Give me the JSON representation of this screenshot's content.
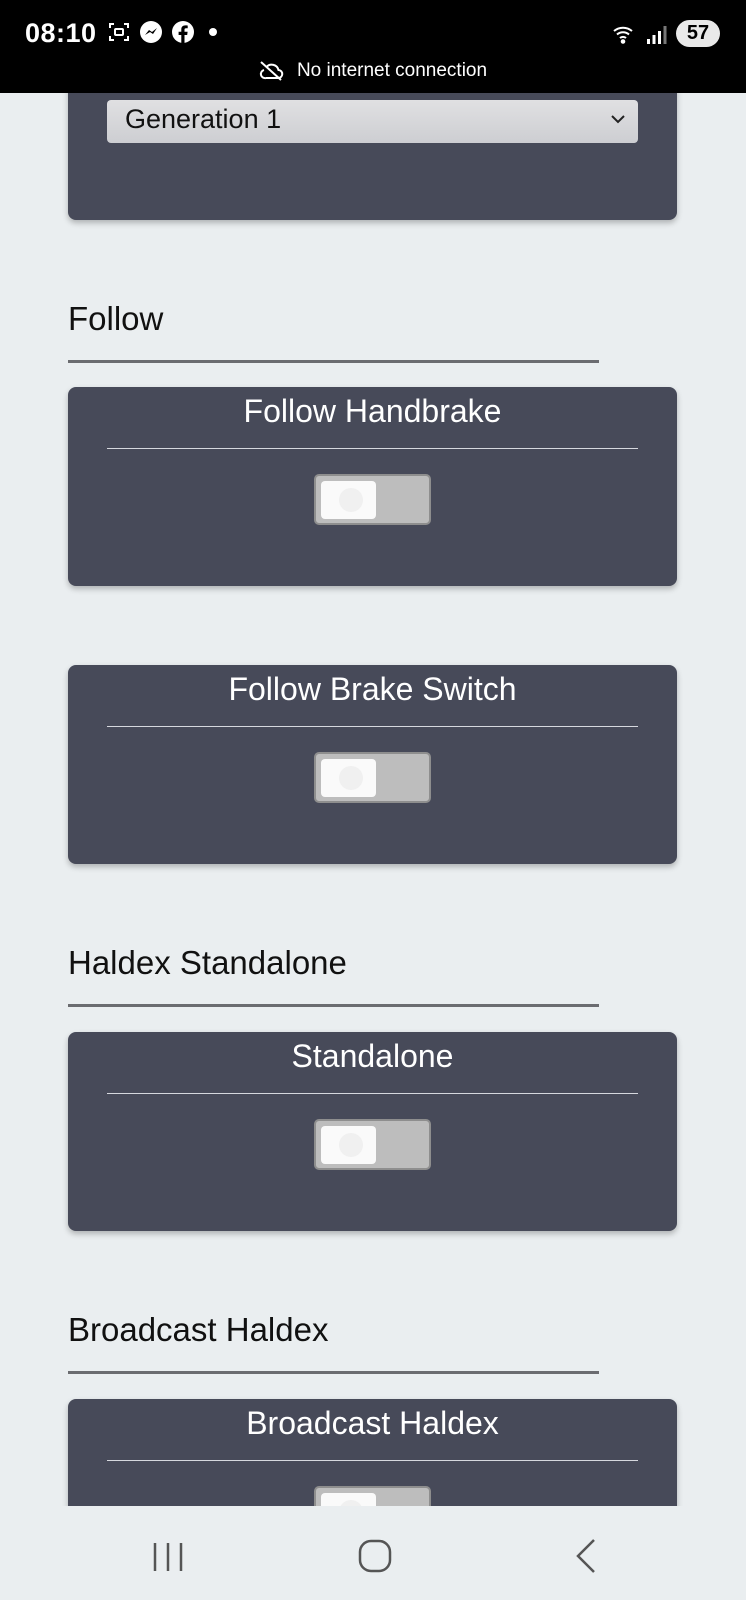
{
  "status_bar": {
    "time": "08:10",
    "battery": "57",
    "connection_text": "No internet connection"
  },
  "icons": {
    "screenshot": "screenshot-icon",
    "messenger": "messenger-icon",
    "facebook": "facebook-icon",
    "wifi": "wifi-icon",
    "signal": "signal-icon",
    "cloud_off": "cloud-off-icon",
    "chevron": "chevron-down-icon"
  },
  "generation_select": {
    "value": "Generation 1"
  },
  "sections": {
    "follow": "Follow",
    "haldex_standalone": "Haldex Standalone",
    "broadcast_haldex": "Broadcast Haldex"
  },
  "cards": {
    "follow_handbrake": {
      "title": "Follow Handbrake",
      "enabled": false
    },
    "follow_brake_switch": {
      "title": "Follow Brake Switch",
      "enabled": false
    },
    "standalone": {
      "title": "Standalone",
      "enabled": false
    },
    "broadcast_haldex": {
      "title": "Broadcast Haldex",
      "enabled": false
    }
  },
  "colors": {
    "card_bg": "#474a59",
    "page_bg": "#eaeef0",
    "toggle_off": "#bdbdbd"
  }
}
